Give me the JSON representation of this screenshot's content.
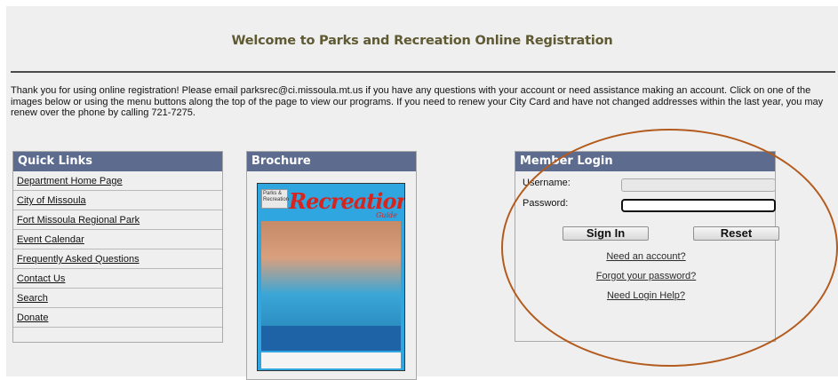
{
  "welcome_title": "Welcome to Parks and Recreation Online Registration",
  "intro_text": "Thank you for using online registration! Please email parksrec@ci.missoula.mt.us if you have any questions with your account or need assistance making an account. Click on one of the images below or using the menu buttons along the top of the page to view our programs. If you need to renew your City Card and have not changed addresses within the last year, you may renew over the phone by calling 721-7275.",
  "quick_links": {
    "title": "Quick Links",
    "items": [
      "Department Home Page",
      "City of Missoula",
      "Fort Missoula Regional Park",
      "Event Calendar",
      "Frequently Asked Questions",
      "Contact Us",
      "Search",
      "Donate"
    ]
  },
  "brochure": {
    "title": "Brochure",
    "cover_title": "Recreation",
    "cover_logo": "Parks & Recreation",
    "cover_subtitle": "Guide"
  },
  "login": {
    "title": "Member Login",
    "username_label": "Username:",
    "password_label": "Password:",
    "username_value": "",
    "password_value": "",
    "sign_in": "Sign In",
    "reset": "Reset",
    "need_account": "Need an account?",
    "forgot_password": "Forgot your password?",
    "login_help": "Need Login Help?"
  },
  "colors": {
    "panel_header": "#5d6b8f",
    "title_text": "#5f5a34",
    "highlight_oval": "#b35b1d"
  }
}
